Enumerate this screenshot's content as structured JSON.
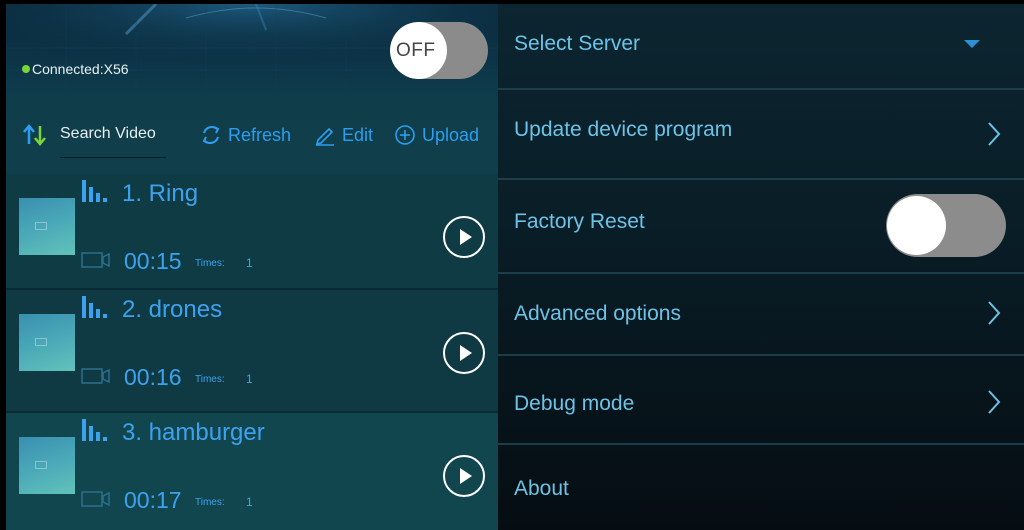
{
  "header": {
    "connection_status": "Connected:X56",
    "power_toggle_label": "OFF"
  },
  "toolbar": {
    "search_label": "Search Video",
    "refresh_label": "Refresh",
    "edit_label": "Edit",
    "upload_label": "Upload"
  },
  "videos": [
    {
      "title": "1. Ring",
      "duration": "00:15",
      "times_label": "Times:",
      "times": "1"
    },
    {
      "title": "2. drones",
      "duration": "00:16",
      "times_label": "Times:",
      "times": "1"
    },
    {
      "title": "3. hamburger",
      "duration": "00:17",
      "times_label": "Times:",
      "times": "1"
    }
  ],
  "settings": {
    "select_server": "Select Server",
    "update_program": "Update device program",
    "factory_reset": "Factory Reset",
    "advanced_options": "Advanced options",
    "debug_mode": "Debug mode",
    "about": "About"
  },
  "colors": {
    "accent_blue": "#3da2ee",
    "connected_dot": "#7bd43c",
    "settings_text": "#6cc3e6",
    "toggle_track": "#8c8c8c"
  },
  "icons": {
    "sort": "sort-icon",
    "refresh": "refresh-icon",
    "edit": "edit-icon",
    "upload": "upload-plus-icon",
    "play": "play-icon",
    "bars": "audio-bars-icon",
    "camera": "video-camera-icon",
    "chevron": "chevron-right-icon",
    "dropdown": "caret-down-icon"
  },
  "state": {
    "power_toggle_on": false,
    "factory_reset_on": false
  }
}
